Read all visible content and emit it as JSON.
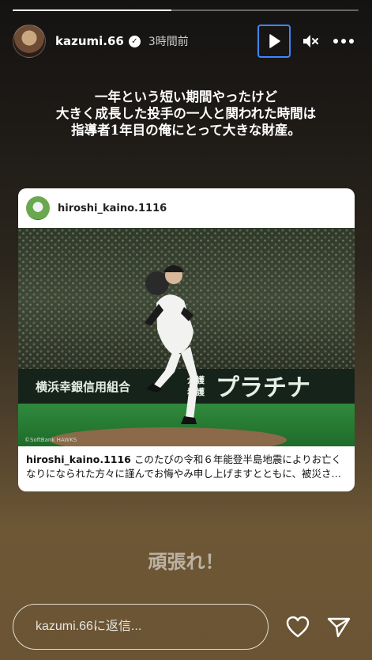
{
  "story": {
    "progress_fraction": 0.46,
    "username": "kazumi.66",
    "verified_symbol": "✓",
    "timestamp": "3時間前",
    "caption_lines": [
      "一年という短い期間やったけど",
      "大きく成長した投手の一人と関われた時間は",
      "指導者1年目の俺にとって大きな財産。"
    ],
    "cheer_text": "頑張れ！"
  },
  "controls": {
    "play_icon": "play-icon",
    "mute_icon": "mute-icon",
    "more_icon": "more-icon"
  },
  "post": {
    "username": "hiroshi_kaino.1116",
    "caption_user": "hiroshi_kaino.1116",
    "caption_text": " このたびの令和６年能登半島地震によりお亡くなりになられた方々に謹んでお悔やみ申し上げますとともに、被災さ…",
    "photo": {
      "banner_left": "横浜幸銀信用組合",
      "banner_right_top": "介護",
      "banner_right_bottom": "看護",
      "banner_big": "プラチナ",
      "credit": "©SoftBank HAWKS"
    }
  },
  "footer": {
    "reply_placeholder": "kazumi.66に返信...",
    "like_icon": "heart-icon",
    "send_icon": "paper-plane-icon"
  },
  "colors": {
    "focus_ring": "#3d86ff",
    "card_bg": "#ffffff"
  }
}
